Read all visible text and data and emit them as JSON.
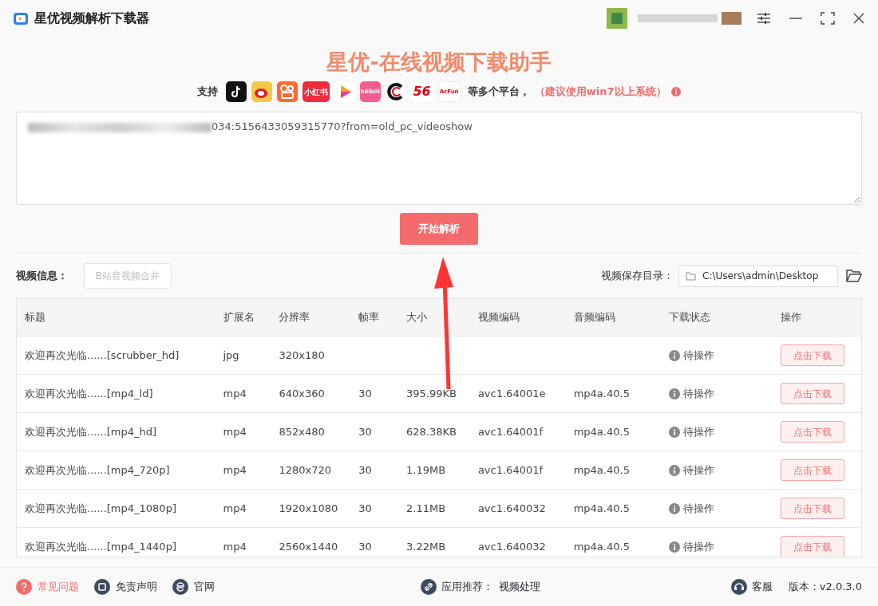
{
  "window": {
    "title": "星优视频解析下载器"
  },
  "heading": "星优-在线视频下载助手",
  "support": {
    "label": "支持",
    "platforms": [
      {
        "kind": "tiktok",
        "color": "#111111"
      },
      {
        "kind": "weibo",
        "color": "#f7c843"
      },
      {
        "kind": "kuaishou",
        "color": "#ff6a2c"
      },
      {
        "kind": "text",
        "color": "#ee2a3c",
        "label": "小红书"
      },
      {
        "kind": "play"
      },
      {
        "kind": "text",
        "color": "#f25d8e",
        "label": "bilibili"
      },
      {
        "kind": "c"
      },
      {
        "kind": "big",
        "label": "56"
      },
      {
        "kind": "small",
        "label": "AcFun"
      }
    ],
    "suffix": "等多个平台，",
    "note": "（建议使用win7以上系统）"
  },
  "url_box": {
    "value": "034:5156433059315770?from=old_pc_videoshow"
  },
  "parse_button": "开始解析",
  "info": {
    "label": "视频信息：",
    "merge_button": "B站音视频合并",
    "merge_disabled": true,
    "save_label": "视频保存目录：",
    "save_path": "C:\\Users\\admin\\Desktop"
  },
  "table": {
    "columns": [
      "标题",
      "扩展名",
      "分辨率",
      "帧率",
      "大小",
      "视频编码",
      "音频编码",
      "下载状态",
      "操作"
    ],
    "rows": [
      {
        "cells": [
          "欢迎再次光临......[scrubber_hd]",
          "jpg",
          "320x180",
          "",
          "",
          "",
          ""
        ],
        "status": "待操作",
        "action": "点击下载"
      },
      {
        "cells": [
          "欢迎再次光临......[mp4_ld]",
          "mp4",
          "640x360",
          "30",
          "395.99KB",
          "avc1.64001e",
          "mp4a.40.5"
        ],
        "status": "待操作",
        "action": "点击下载"
      },
      {
        "cells": [
          "欢迎再次光临......[mp4_hd]",
          "mp4",
          "852x480",
          "30",
          "628.38KB",
          "avc1.64001f",
          "mp4a.40.5"
        ],
        "status": "待操作",
        "action": "点击下载"
      },
      {
        "cells": [
          "欢迎再次光临......[mp4_720p]",
          "mp4",
          "1280x720",
          "30",
          "1.19MB",
          "avc1.64001f",
          "mp4a.40.5"
        ],
        "status": "待操作",
        "action": "点击下载"
      },
      {
        "cells": [
          "欢迎再次光临......[mp4_1080p]",
          "mp4",
          "1920x1080",
          "30",
          "2.11MB",
          "avc1.640032",
          "mp4a.40.5"
        ],
        "status": "待操作",
        "action": "点击下载"
      },
      {
        "cells": [
          "欢迎再次光临......[mp4_1440p]",
          "mp4",
          "2560x1440",
          "30",
          "3.22MB",
          "avc1.640032",
          "mp4a.40.5"
        ],
        "status": "待操作",
        "action": "点击下载"
      }
    ]
  },
  "footer": {
    "left": [
      {
        "kind": "question",
        "label": "常见问题",
        "color": "#f46b6b"
      },
      {
        "kind": "disclaimer",
        "label": "免责声明",
        "color": "#3f4a5e"
      },
      {
        "kind": "web",
        "label": "官网",
        "color": "#3f4a5e"
      }
    ],
    "recommend_label": "应用推荐：",
    "recommend_link": "视频处理",
    "service": "客服",
    "version": "版本：v2.0.3.0"
  }
}
